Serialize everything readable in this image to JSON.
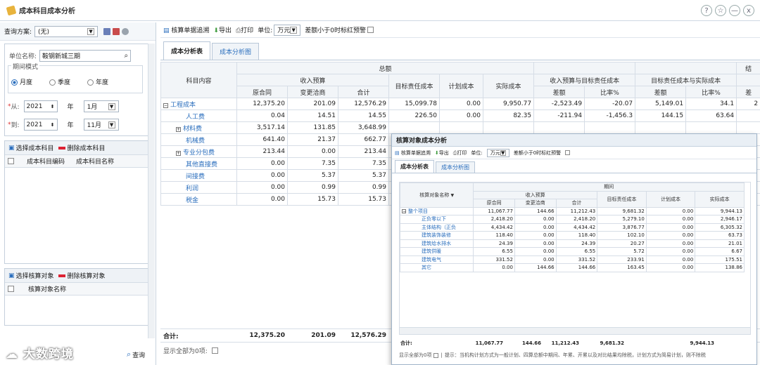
{
  "window": {
    "title": "成本科目成本分析",
    "help": "?",
    "star": "☆",
    "min": "—",
    "close": "x"
  },
  "left": {
    "scheme_label": "查询方案:",
    "scheme_value": "(无)",
    "unit_label": "单位名称:",
    "unit_value": "鞍钢新城三期",
    "period_label": "期间模式",
    "modes": [
      "月度",
      "季度",
      "年度"
    ],
    "from_label": "从:",
    "from_year": "2021",
    "from_year_unit": "年",
    "from_month": "1月",
    "to_label": "到:",
    "to_year": "2021",
    "to_year_unit": "年",
    "to_month": "11月",
    "subject_select": "选择成本科目",
    "subject_delete": "删除成本科目",
    "col_code": "成本科目编码",
    "col_name": "成本科目名称",
    "obj_select": "选择核算对象",
    "obj_delete": "删除核算对象",
    "obj_col_name": "核算对象名称",
    "query_btn": "查询"
  },
  "main": {
    "toolbar": {
      "trace": "核算单据追溯",
      "export": "导出",
      "print": "打印",
      "unit_label": "单位:",
      "unit_value": "万元",
      "alert": "差额小于0时标红预警"
    },
    "tabs": [
      "成本分析表",
      "成本分析图"
    ],
    "header": {
      "content": "科目内容",
      "total": "总额",
      "income_budget": "收入预算",
      "orig": "原合同",
      "change": "变更洽商",
      "sum": "合计",
      "target": "目标责任成本",
      "plan": "计划成本",
      "actual": "实际成本",
      "grp1": "收入预算与目标责任成本",
      "grp2": "目标责任成本与实际成本",
      "diff": "差额",
      "ratio": "比率%",
      "cutoff": "结",
      "cutoff2": "差"
    },
    "rows": [
      {
        "name": "工程成本",
        "orig": "12,375.20",
        "change": "201.09",
        "sum": "12,576.29",
        "target": "15,099.78",
        "plan": "0.00",
        "actual": "9,950.77",
        "d1": "-2,523.49",
        "r1": "-20.07",
        "d2": "5,149.01",
        "r2": "34.1",
        "d3": "2"
      },
      {
        "name": "人工费",
        "orig": "0.04",
        "change": "14.51",
        "sum": "14.55",
        "target": "226.50",
        "plan": "0.00",
        "actual": "82.35",
        "d1": "-211.94",
        "r1": "-1,456.3",
        "d2": "144.15",
        "r2": "63.64",
        "d3": ""
      },
      {
        "name": "材料费",
        "orig": "3,517.14",
        "change": "131.85",
        "sum": "3,648.99",
        "target": "",
        "plan": "",
        "actual": "",
        "d1": "",
        "r1": "",
        "d2": "",
        "r2": "",
        "d3": ""
      },
      {
        "name": "机械费",
        "orig": "641.40",
        "change": "21.37",
        "sum": "662.77",
        "target": "",
        "plan": "",
        "actual": "",
        "d1": "",
        "r1": "",
        "d2": "",
        "r2": "",
        "d3": ""
      },
      {
        "name": "专业分包费",
        "orig": "213.44",
        "change": "0.00",
        "sum": "213.44",
        "target": "",
        "plan": "",
        "actual": "",
        "d1": "",
        "r1": "",
        "d2": "",
        "r2": "",
        "d3": ""
      },
      {
        "name": "其他直接费",
        "orig": "0.00",
        "change": "7.35",
        "sum": "7.35",
        "target": "",
        "plan": "",
        "actual": "",
        "d1": "",
        "r1": "",
        "d2": "",
        "r2": "",
        "d3": ""
      },
      {
        "name": "间接费",
        "orig": "0.00",
        "change": "5.37",
        "sum": "5.37",
        "target": "",
        "plan": "",
        "actual": "",
        "d1": "",
        "r1": "",
        "d2": "",
        "r2": "",
        "d3": ""
      },
      {
        "name": "利润",
        "orig": "0.00",
        "change": "0.99",
        "sum": "0.99",
        "target": "",
        "plan": "",
        "actual": "",
        "d1": "",
        "r1": "",
        "d2": "",
        "r2": "",
        "d3": ""
      },
      {
        "name": "税金",
        "orig": "0.00",
        "change": "15.73",
        "sum": "15.73",
        "target": "",
        "plan": "",
        "actual": "",
        "d1": "",
        "r1": "",
        "d2": "",
        "r2": "",
        "d3": ""
      }
    ],
    "total_label": "合计:",
    "total_orig": "12,375.20",
    "total_change": "201.09",
    "total_sum": "12,576.29",
    "footer_label": "显示全部为0项:"
  },
  "popup": {
    "title": "核算对象成本分析",
    "toolbar": {
      "trace": "核算单据追溯",
      "export": "导出",
      "print": "打印",
      "unit_label": "单位:",
      "unit_value": "万元",
      "alert": "差额小于0时标红预警"
    },
    "tabs": [
      "成本分析表",
      "成本分析图"
    ],
    "header": {
      "obj": "核算对象名称",
      "period": "期间",
      "income": "收入预算",
      "orig": "原合同",
      "change": "变更洽商",
      "sum": "合计",
      "target": "目标责任成本",
      "plan": "计划成本",
      "actual": "实际成本"
    },
    "rows": [
      {
        "name": "整个项目",
        "orig": "11,067.77",
        "change": "144.66",
        "sum": "11,212.43",
        "target": "9,681.32",
        "plan": "0.00",
        "actual": "9,944.13"
      },
      {
        "name": "正负零以下",
        "orig": "2,418.20",
        "change": "0.00",
        "sum": "2,418.20",
        "target": "5,279.10",
        "plan": "0.00",
        "actual": "2,946.17"
      },
      {
        "name": "主体结构（正负",
        "orig": "4,434.42",
        "change": "0.00",
        "sum": "4,434.42",
        "target": "3,876.77",
        "plan": "0.00",
        "actual": "6,305.32"
      },
      {
        "name": "建筑装饰装修",
        "orig": "118.40",
        "change": "0.00",
        "sum": "118.40",
        "target": "102.10",
        "plan": "0.00",
        "actual": "63.73"
      },
      {
        "name": "建筑给水排水",
        "orig": "24.39",
        "change": "0.00",
        "sum": "24.39",
        "target": "20.27",
        "plan": "0.00",
        "actual": "21.01"
      },
      {
        "name": "建筑供暖",
        "orig": "6.55",
        "change": "0.00",
        "sum": "6.55",
        "target": "5.72",
        "plan": "0.00",
        "actual": "6.67"
      },
      {
        "name": "建筑电气",
        "orig": "331.52",
        "change": "0.00",
        "sum": "331.52",
        "target": "233.91",
        "plan": "0.00",
        "actual": "175.51"
      },
      {
        "name": "其它",
        "orig": "0.00",
        "change": "144.66",
        "sum": "144.66",
        "target": "163.45",
        "plan": "0.00",
        "actual": "138.86"
      }
    ],
    "total_label": "合计:",
    "total_orig": "11,067.77",
    "total_change": "144.66",
    "total_sum": "11,212.43",
    "total_target": "9,681.32",
    "total_actual": "9,944.13",
    "footer": "显示全部为0项",
    "hint": "提示：当机构计划方式为一般计划、四算总额中期间、年累、开累以及对比结果均除税，计划方式为简易计划，则不除税"
  },
  "watermark": "大数跨境"
}
